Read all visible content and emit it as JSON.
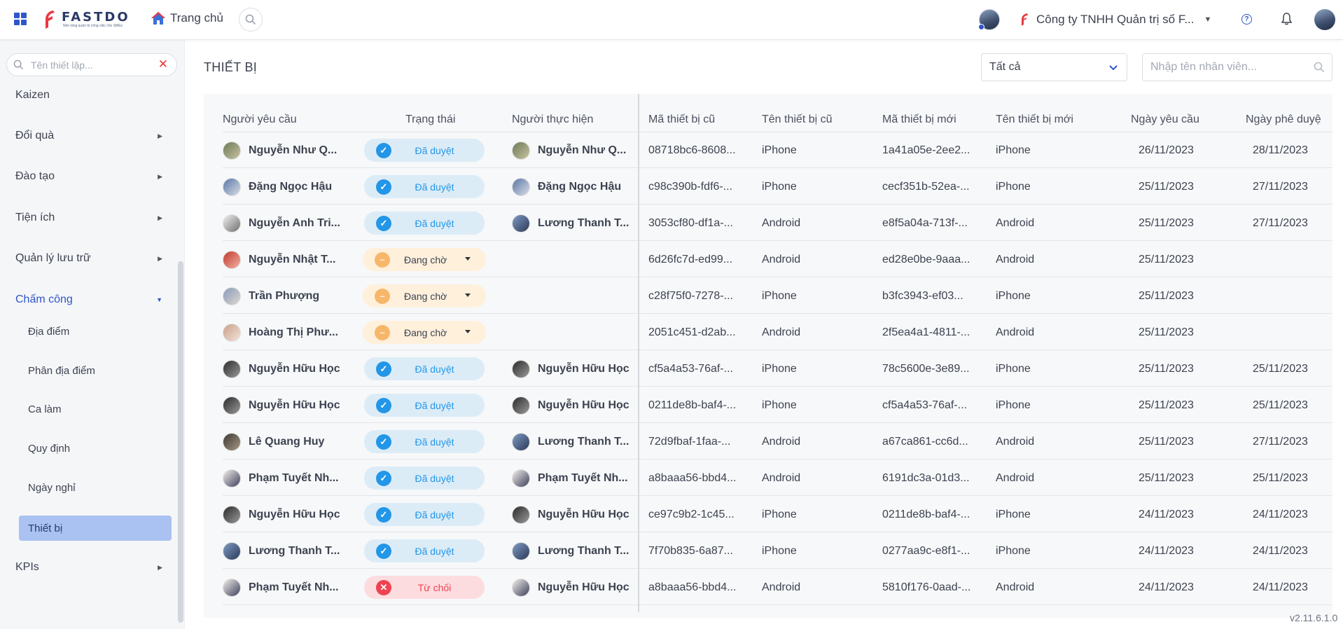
{
  "topbar": {
    "logo_text": "FASTDO",
    "logo_tagline": "Nền tảng quản trị công việc cho SMEs",
    "home_label": "Trang chủ",
    "company_name": "Công ty TNHH Quản trị số F...",
    "icons": [
      "apps-grid-icon",
      "home-icon",
      "search-icon",
      "help-icon",
      "bell-icon"
    ]
  },
  "sidebar": {
    "search_placeholder": "Tên thiết lập...",
    "items": [
      {
        "label": "Kaizen"
      },
      {
        "label": "Đổi quà"
      },
      {
        "label": "Đào tạo"
      },
      {
        "label": "Tiện ích"
      },
      {
        "label": "Quản lý lưu trữ"
      },
      {
        "label": "Chấm công"
      },
      {
        "label": "KPIs"
      }
    ],
    "sub_items": [
      {
        "label": "Địa điểm"
      },
      {
        "label": "Phân địa điểm"
      },
      {
        "label": "Ca làm"
      },
      {
        "label": "Quy định"
      },
      {
        "label": "Ngày nghỉ"
      },
      {
        "label": "Thiết bị"
      }
    ]
  },
  "main": {
    "title": "THIẾT BỊ",
    "filter_value": "Tất cả",
    "employee_search_placeholder": "Nhập tên nhân viên...",
    "columns": [
      "Người yêu cầu",
      "Trạng thái",
      "Người thực hiện",
      "Mã thiết bị cũ",
      "Tên thiết bị cũ",
      "Mã thiết bị mới",
      "Tên thiết bị mới",
      "Ngày yêu cầu",
      "Ngày phê duyệ"
    ],
    "rows": [
      {
        "requester": "Nguyễn Như Q...",
        "status": "Đã duyệt",
        "status_type": "approved",
        "executor": "Nguyễn Như Q...",
        "old_id": "08718bc6-8608...",
        "old_name": "iPhone",
        "new_id": "1a41a05e-2ee2...",
        "new_name": "iPhone",
        "req_date": "26/11/2023",
        "appr_date": "28/11/2023"
      },
      {
        "requester": "Đặng Ngọc Hậu",
        "status": "Đã duyệt",
        "status_type": "approved",
        "executor": "Đặng Ngọc Hậu",
        "old_id": "c98c390b-fdf6-...",
        "old_name": "iPhone",
        "new_id": "cecf351b-52ea-...",
        "new_name": "iPhone",
        "req_date": "25/11/2023",
        "appr_date": "27/11/2023"
      },
      {
        "requester": "Nguyễn Anh Tri...",
        "status": "Đã duyệt",
        "status_type": "approved",
        "executor": "Lương Thanh T...",
        "old_id": "3053cf80-df1a-...",
        "old_name": "Android",
        "new_id": "e8f5a04a-713f-...",
        "new_name": "Android",
        "req_date": "25/11/2023",
        "appr_date": "27/11/2023"
      },
      {
        "requester": "Nguyễn Nhật T...",
        "status": "Đang chờ",
        "status_type": "pending",
        "executor": "",
        "old_id": "6d26fc7d-ed99...",
        "old_name": "Android",
        "new_id": "ed28e0be-9aaa...",
        "new_name": "Android",
        "req_date": "25/11/2023",
        "appr_date": ""
      },
      {
        "requester": "Trần Phượng",
        "status": "Đang chờ",
        "status_type": "pending",
        "executor": "",
        "old_id": "c28f75f0-7278-...",
        "old_name": "iPhone",
        "new_id": "b3fc3943-ef03...",
        "new_name": "iPhone",
        "req_date": "25/11/2023",
        "appr_date": ""
      },
      {
        "requester": "Hoàng Thị Phư...",
        "status": "Đang chờ",
        "status_type": "pending",
        "executor": "",
        "old_id": "2051c451-d2ab...",
        "old_name": "Android",
        "new_id": "2f5ea4a1-4811-...",
        "new_name": "Android",
        "req_date": "25/11/2023",
        "appr_date": ""
      },
      {
        "requester": "Nguyễn Hữu Học",
        "status": "Đã duyệt",
        "status_type": "approved",
        "executor": "Nguyễn Hữu Học",
        "old_id": "cf5a4a53-76af-...",
        "old_name": "iPhone",
        "new_id": "78c5600e-3e89...",
        "new_name": "iPhone",
        "req_date": "25/11/2023",
        "appr_date": "25/11/2023"
      },
      {
        "requester": "Nguyễn Hữu Học",
        "status": "Đã duyệt",
        "status_type": "approved",
        "executor": "Nguyễn Hữu Học",
        "old_id": "0211de8b-baf4-...",
        "old_name": "iPhone",
        "new_id": "cf5a4a53-76af-...",
        "new_name": "iPhone",
        "req_date": "25/11/2023",
        "appr_date": "25/11/2023"
      },
      {
        "requester": "Lê Quang Huy",
        "status": "Đã duyệt",
        "status_type": "approved",
        "executor": "Lương Thanh T...",
        "old_id": "72d9fbaf-1faa-...",
        "old_name": "Android",
        "new_id": "a67ca861-cc6d...",
        "new_name": "Android",
        "req_date": "25/11/2023",
        "appr_date": "27/11/2023"
      },
      {
        "requester": "Phạm Tuyết Nh...",
        "status": "Đã duyệt",
        "status_type": "approved",
        "executor": "Phạm Tuyết Nh...",
        "old_id": "a8baaa56-bbd4...",
        "old_name": "Android",
        "new_id": "6191dc3a-01d3...",
        "new_name": "Android",
        "req_date": "25/11/2023",
        "appr_date": "25/11/2023"
      },
      {
        "requester": "Nguyễn Hữu Học",
        "status": "Đã duyệt",
        "status_type": "approved",
        "executor": "Nguyễn Hữu Học",
        "old_id": "ce97c9b2-1c45...",
        "old_name": "iPhone",
        "new_id": "0211de8b-baf4-...",
        "new_name": "iPhone",
        "req_date": "24/11/2023",
        "appr_date": "24/11/2023"
      },
      {
        "requester": "Lương Thanh T...",
        "status": "Đã duyệt",
        "status_type": "approved",
        "executor": "Lương Thanh T...",
        "old_id": "7f70b835-6a87...",
        "old_name": "iPhone",
        "new_id": "0277aa9c-e8f1-...",
        "new_name": "iPhone",
        "req_date": "24/11/2023",
        "appr_date": "24/11/2023"
      },
      {
        "requester": "Phạm Tuyết Nh...",
        "status": "Từ chối",
        "status_type": "rejected",
        "executor": "Nguyễn Hữu Học",
        "old_id": "a8baaa56-bbd4...",
        "old_name": "Android",
        "new_id": "5810f176-0aad-...",
        "new_name": "Android",
        "req_date": "24/11/2023",
        "appr_date": "24/11/2023"
      }
    ]
  },
  "version": "v2.11.6.1.0",
  "colors": {
    "accent": "#2f56c9",
    "approved": "#2396e8",
    "pending": "#f7b76a",
    "rejected": "#ef4352",
    "selected_bg": "#a9c2f1"
  }
}
